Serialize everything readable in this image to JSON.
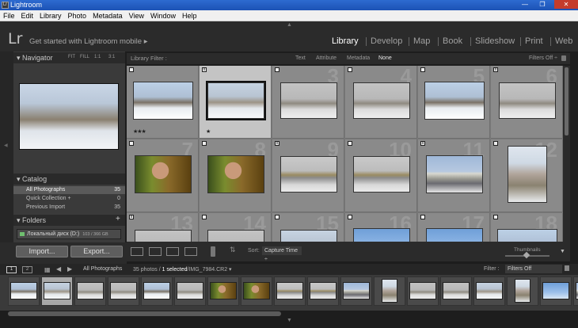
{
  "window": {
    "title": "Lightroom",
    "min": "—",
    "max": "❐",
    "close": "✕"
  },
  "menu": [
    "File",
    "Edit",
    "Library",
    "Photo",
    "Metadata",
    "View",
    "Window",
    "Help"
  ],
  "identity": {
    "logo": "Lr",
    "mobile": "Get started with Lightroom mobile",
    "mobile_arrow": "▸"
  },
  "modules": [
    "Library",
    "Develop",
    "Map",
    "Book",
    "Slideshow",
    "Print",
    "Web"
  ],
  "active_module": "Library",
  "navigator": {
    "title": "Navigator",
    "options": [
      "FIT",
      "FILL",
      "1:1",
      "3:1"
    ]
  },
  "catalog": {
    "title": "Catalog",
    "rows": [
      {
        "label": "All Photographs",
        "count": "35"
      },
      {
        "label": "Quick Collection +",
        "count": "0"
      },
      {
        "label": "Previous Import",
        "count": "35"
      }
    ]
  },
  "folders": {
    "title": "Folders",
    "add": "+",
    "drive_name": "Локальный диск (D:)",
    "drive_cap": "103 / 366 GB"
  },
  "buttons": {
    "import": "Import...",
    "export": "Export..."
  },
  "filter": {
    "label": "Library Filter :",
    "tabs": [
      "Text",
      "Attribute",
      "Metadata",
      "None"
    ],
    "active": "None",
    "filters_off": "Filters Off ÷"
  },
  "grid": {
    "cells": [
      {
        "num": "",
        "badge": "",
        "stars": "★★★",
        "img": "snow"
      },
      {
        "num": "",
        "badge": "x",
        "stars": "★",
        "img": "snow2",
        "selected": true
      },
      {
        "num": "3",
        "badge": "",
        "stars": "",
        "img": "snowgray"
      },
      {
        "num": "4",
        "badge": "",
        "stars": "",
        "img": "snowgray"
      },
      {
        "num": "5",
        "badge": "",
        "stars": "",
        "img": "snow"
      },
      {
        "num": "6",
        "badge": "x",
        "stars": "",
        "img": "snowgray"
      },
      {
        "num": "7",
        "badge": "",
        "stars": "",
        "img": "portrait"
      },
      {
        "num": "8",
        "badge": "",
        "stars": "",
        "img": "portrait"
      },
      {
        "num": "9",
        "badge": "x",
        "stars": "",
        "img": "church"
      },
      {
        "num": "10",
        "badge": "",
        "stars": "",
        "img": "church"
      },
      {
        "num": "11",
        "badge": "x",
        "stars": "",
        "img": "building"
      },
      {
        "num": "12",
        "badge": "",
        "stars": "",
        "img": "tower"
      },
      {
        "num": "13",
        "badge": "x",
        "stars": "",
        "img": "snowgray"
      },
      {
        "num": "14",
        "badge": "",
        "stars": "",
        "img": "snowgray"
      },
      {
        "num": "15",
        "badge": "",
        "stars": "",
        "img": "snow2"
      },
      {
        "num": "16",
        "badge": "",
        "stars": "",
        "img": "sky"
      },
      {
        "num": "17",
        "badge": "",
        "stars": "",
        "img": "sky"
      },
      {
        "num": "18",
        "badge": "",
        "stars": "",
        "img": "snow"
      }
    ]
  },
  "toolbar": {
    "sort_label": "Sort:",
    "sort_value": "Capture Time ÷",
    "thumbnails": "Thumbnails"
  },
  "filmstrip": {
    "pages": [
      "1",
      "2"
    ],
    "source": "All Photographs",
    "info": "35 photos /",
    "selected": "1 selected",
    "filename": "/IMG_7984.CR2 ▾",
    "filter_label": "Filter :",
    "filter_value": "Filters Off"
  }
}
